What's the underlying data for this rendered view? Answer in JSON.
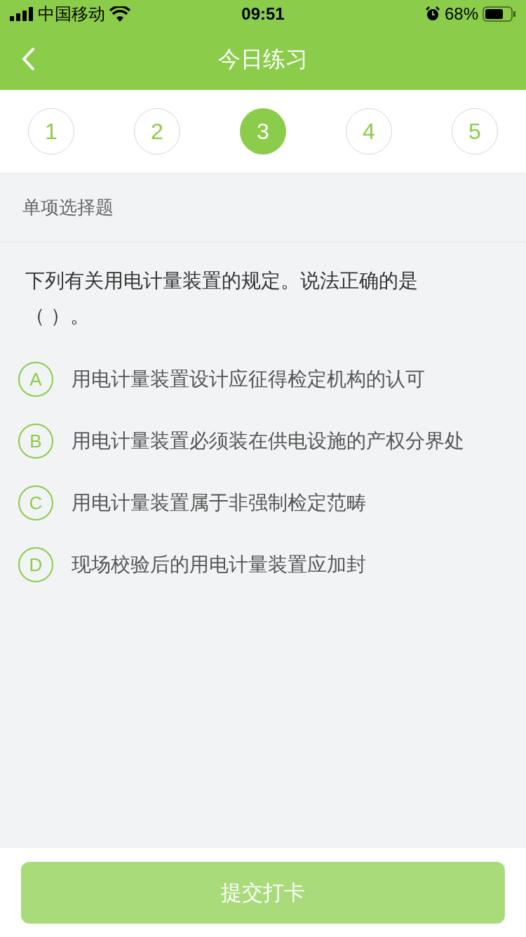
{
  "status_bar": {
    "carrier": "中国移动",
    "time": "09:51",
    "battery": "68%"
  },
  "header": {
    "title": "今日练习"
  },
  "steps": [
    {
      "label": "1",
      "selected": false
    },
    {
      "label": "2",
      "selected": false
    },
    {
      "label": "3",
      "selected": true
    },
    {
      "label": "4",
      "selected": false
    },
    {
      "label": "5",
      "selected": false
    }
  ],
  "section": {
    "label": "单项选择题"
  },
  "question": {
    "text": "下列有关用电计量装置的规定。说法正确的是（ ）。"
  },
  "options": [
    {
      "letter": "A",
      "text": "用电计量装置设计应征得检定机构的认可",
      "selected": false
    },
    {
      "letter": "B",
      "text": "用电计量装置必须装在供电设施的产权分界处",
      "selected": false
    },
    {
      "letter": "C",
      "text": "用电计量装置属于非强制检定范畴",
      "selected": false
    },
    {
      "letter": "D",
      "text": "现场校验后的用电计量装置应加封",
      "selected": false
    }
  ],
  "submit": {
    "label": "提交打卡",
    "disabled": true
  }
}
